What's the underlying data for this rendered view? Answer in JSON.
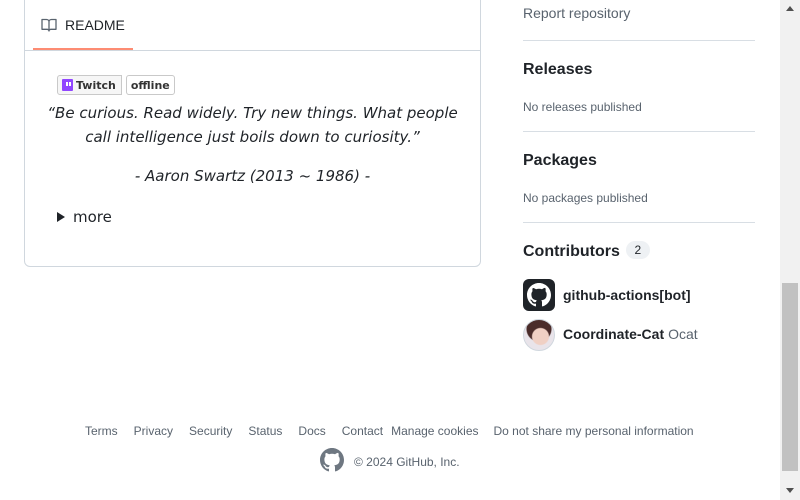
{
  "readme": {
    "tab_label": "README",
    "badge": {
      "left": "Twitch",
      "right": "offline"
    },
    "quote_line1": "“Be curious. Read widely. Try new things. What people",
    "quote_line2": "call intelligence just boils down to curiosity.”",
    "attribution": "- Aaron Swartz (2013 ~ 1986) -",
    "more_label": "more"
  },
  "sidebar": {
    "report_link": "Report repository",
    "releases": {
      "title": "Releases",
      "subtitle": "No releases published"
    },
    "packages": {
      "title": "Packages",
      "subtitle": "No packages published"
    },
    "contributors": {
      "title": "Contributors",
      "count": "2",
      "list": [
        {
          "name": "github-actions[bot]",
          "alias": ""
        },
        {
          "name": "Coordinate-Cat",
          "alias": "Ocat"
        }
      ]
    }
  },
  "footer": {
    "links": [
      "Terms",
      "Privacy",
      "Security",
      "Status",
      "Docs",
      "Contact",
      "Manage cookies",
      "Do not share my personal information"
    ],
    "copyright": "© 2024 GitHub, Inc."
  },
  "icons": {
    "readme": "book-icon",
    "badge": "twitch-icon",
    "more": "triangle-right-icon",
    "footer": "github-mark-icon"
  },
  "colors": {
    "tab_underline": "#fd8c73",
    "border": "#d0d7de",
    "muted_text": "#59636e",
    "twitch": "#9146ff"
  }
}
